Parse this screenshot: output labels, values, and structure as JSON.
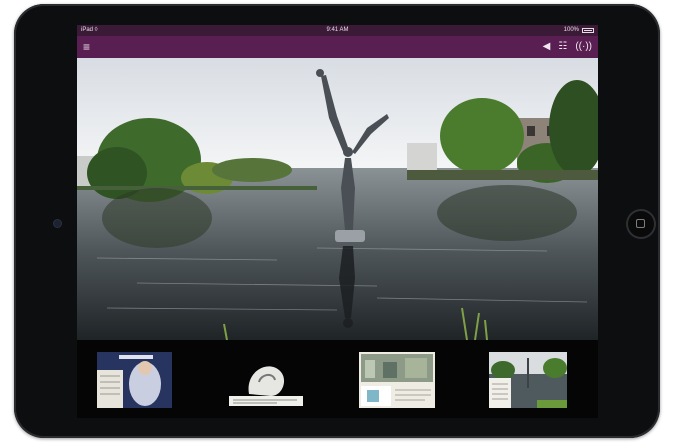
{
  "status_bar": {
    "carrier": "iPad ◊",
    "time": "9:41 AM",
    "battery": "100%"
  },
  "toolbar": {
    "menu_icon": "≡",
    "back_icon": "◀",
    "reader_icon": "☷",
    "audio_icon": "((·))"
  },
  "colors": {
    "status_bar": "#3b1a38",
    "toolbar": "#5a1f52",
    "bezel": "#0d0e10"
  },
  "main_image": {
    "subject": "photo-lake-sculpture"
  },
  "thumbnails": [
    {
      "icon": "thumb-doctor-page"
    },
    {
      "icon": "thumb-sculpture-page"
    },
    {
      "icon": "thumb-clinic-page"
    },
    {
      "icon": "thumb-lake-page"
    }
  ]
}
